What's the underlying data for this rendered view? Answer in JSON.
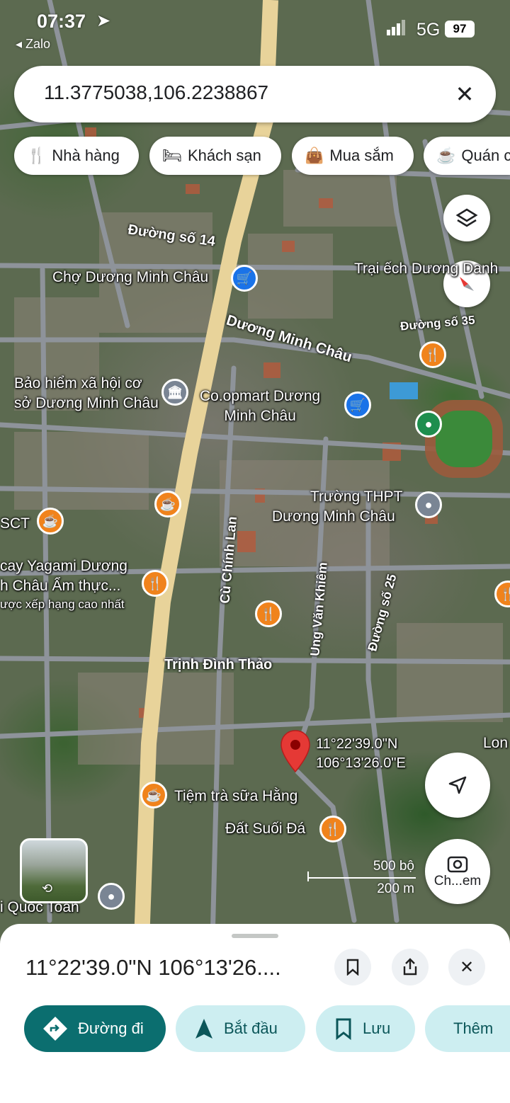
{
  "status_bar": {
    "time": "07:37",
    "back_app": "Zalo",
    "network": "5G",
    "battery": "97"
  },
  "search": {
    "value": "11.3775038,106.2238867"
  },
  "chips": [
    {
      "label": "Nhà hàng",
      "icon": "fork-knife-icon"
    },
    {
      "label": "Khách sạn",
      "icon": "bed-icon"
    },
    {
      "label": "Mua sắm",
      "icon": "shopping-bag-icon"
    },
    {
      "label": "Quán c",
      "icon": "coffee-cup-icon"
    }
  ],
  "map": {
    "roads": [
      "Đường số 14",
      "Dương Minh Châu",
      "Đường số 35",
      "Cù Chính Lan",
      "Ung Văn Khiêm",
      "Đường số 25",
      "Trịnh Đình Thảo"
    ],
    "places": [
      {
        "line1": "Chợ Dương Minh Châu",
        "icon": "cart"
      },
      {
        "line1": "Trại ếch Dương Danh",
        "icon": "none"
      },
      {
        "line1": "Bảo hiểm xã hội cơ",
        "line2": "sở Dương Minh Châu",
        "icon": "bank"
      },
      {
        "line1": "Co.opmart Dương",
        "line2": "Minh Châu",
        "icon": "cart"
      },
      {
        "line1": "Trường THPT",
        "line2": "Dương Minh Châu",
        "icon": "pin"
      },
      {
        "line1": "SCT",
        "icon": "cup"
      },
      {
        "line1": "cay Yagami Dương",
        "line2": "h Châu Ẩm thực...",
        "line3": "ược xếp hạng cao nhất",
        "icon": "food"
      },
      {
        "line1": "Tiệm trà sữa Hằng",
        "icon": "cup"
      },
      {
        "line1": "Đất Suối Đá",
        "icon": "food"
      },
      {
        "line1": "Lon",
        "icon": "none"
      },
      {
        "line1": "i Quốc Toản",
        "icon": "pin"
      }
    ],
    "pin_label": {
      "lat": "11°22'39.0\"N",
      "lon": "106°13'26.0\"E"
    },
    "scale": {
      "imperial": "500 bộ",
      "metric": "200 m"
    },
    "lens_label": "Ch...em"
  },
  "sheet": {
    "title": "11°22'39.0\"N 106°13'26....",
    "actions": [
      {
        "label": "Đường đi",
        "icon": "directions-icon"
      },
      {
        "label": "Bắt đầu",
        "icon": "navigation-arrow-icon"
      },
      {
        "label": "Lưu",
        "icon": "bookmark-icon"
      },
      {
        "label": "Thêm",
        "icon": "flag-icon"
      }
    ]
  }
}
